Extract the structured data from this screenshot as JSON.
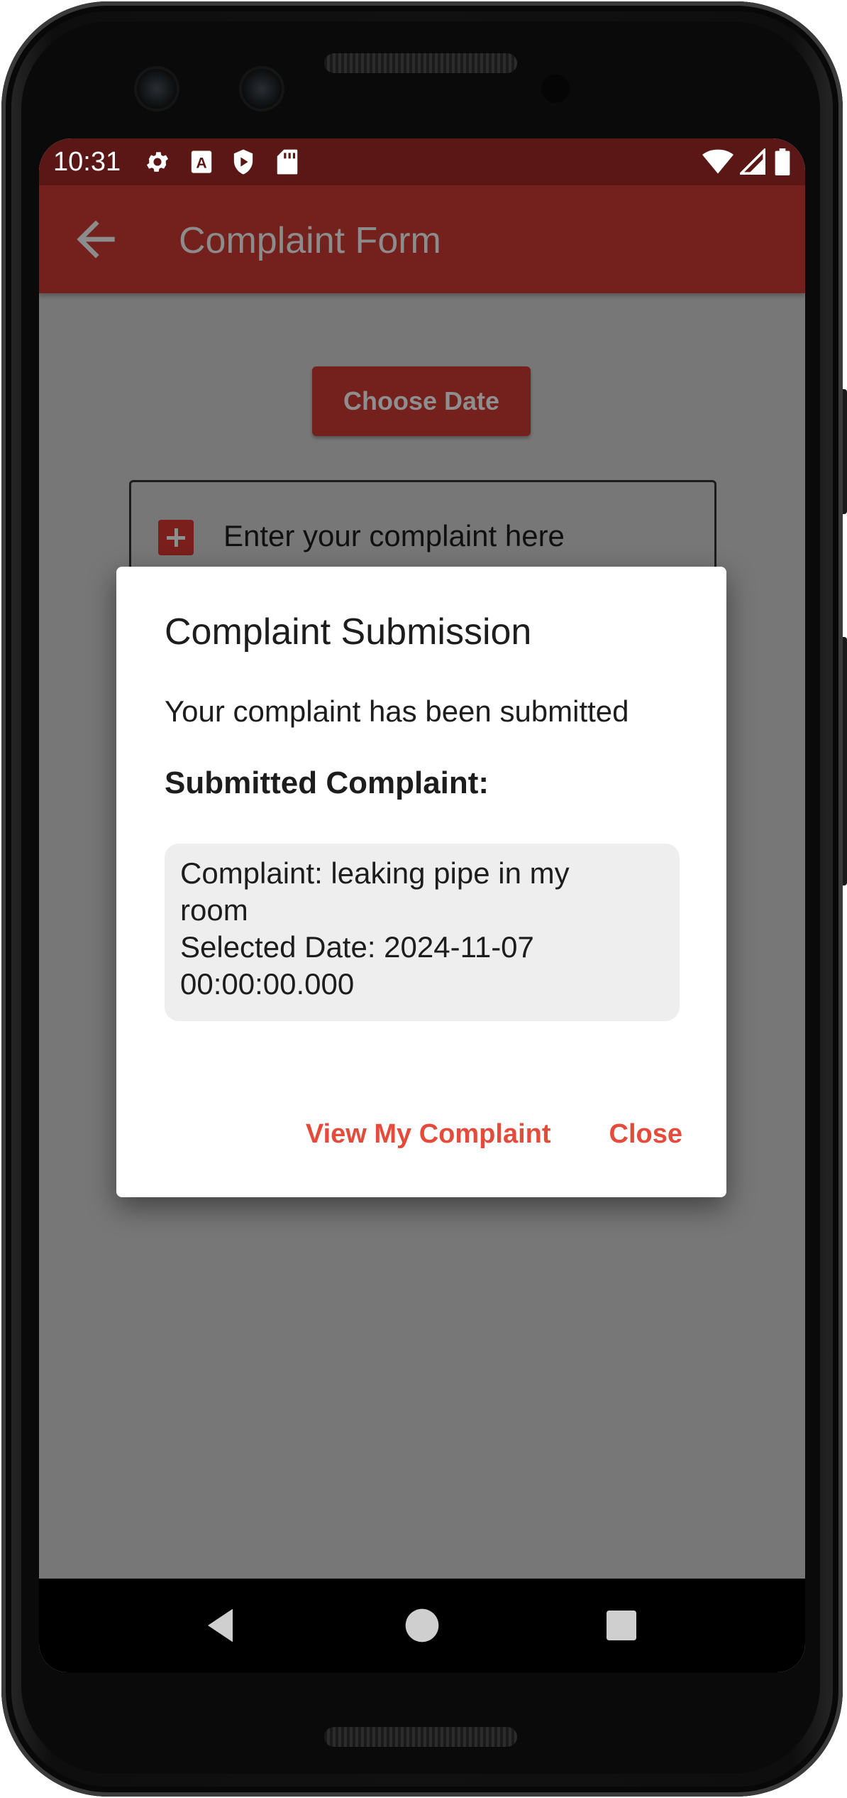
{
  "status_bar": {
    "time": "10:31",
    "left_icons": [
      "settings-icon",
      "a-text-icon",
      "shield-play-icon",
      "sd-card-icon"
    ],
    "right_icons": [
      "wifi-icon",
      "cell-signal-icon",
      "battery-icon"
    ]
  },
  "app_bar": {
    "title": "Complaint Form",
    "back_icon": "arrow-left-icon",
    "color": "#74201c"
  },
  "form": {
    "choose_date_label": "Choose Date",
    "complaint_placeholder": "Enter your complaint here",
    "field_icon": "add-box-icon"
  },
  "dialog": {
    "title": "Complaint Submission",
    "message": "Your complaint has been submitted",
    "subheading": "Submitted Complaint:",
    "complaint_line1": "Complaint: leaking pipe in my",
    "complaint_line2": "room",
    "date_line1": "Selected Date: 2024-11-07",
    "date_line2": "00:00:00.000",
    "view_button": "View My Complaint",
    "close_button": "Close",
    "accent_color": "#e54b3b"
  },
  "nav_bar": {
    "icons": [
      "back-triangle-icon",
      "home-circle-icon",
      "recents-square-icon"
    ]
  }
}
